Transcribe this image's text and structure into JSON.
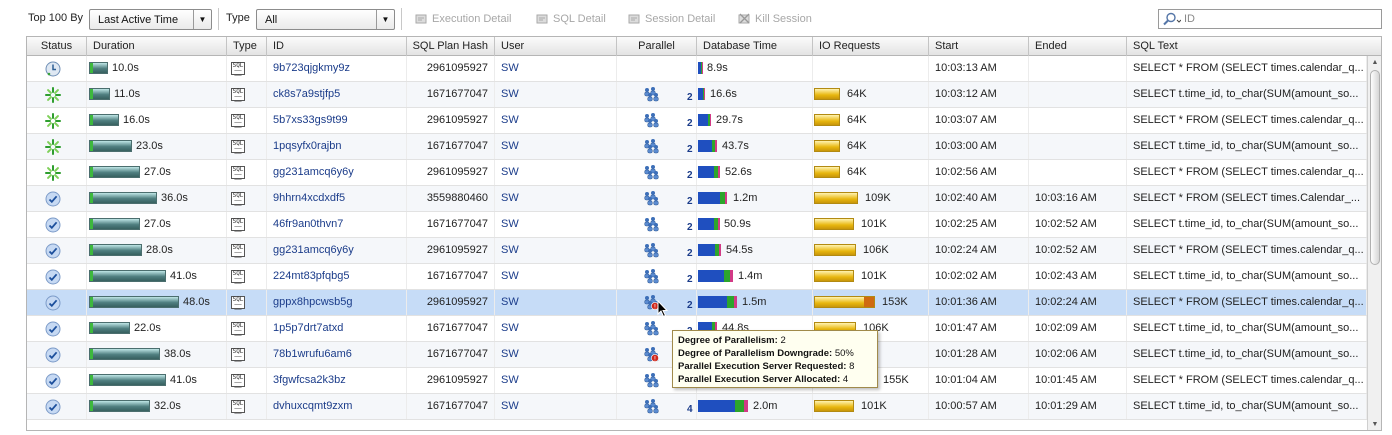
{
  "toolbar": {
    "top_label": "Top 100 By",
    "top_select": "Last Active Time",
    "type_label": "Type",
    "type_select": "All",
    "execution_detail": "Execution Detail",
    "sql_detail": "SQL Detail",
    "session_detail": "Session Detail",
    "kill_session": "Kill Session",
    "search_placeholder": "ID"
  },
  "columns": [
    "Status",
    "Duration",
    "Type",
    "ID",
    "SQL Plan Hash",
    "User",
    "Parallel",
    "Database Time",
    "IO Requests",
    "Start",
    "Ended",
    "SQL Text"
  ],
  "colors": {
    "selected_row": "#c6dcf7",
    "link": "#1b3c8a",
    "io_bar": "#e8b70f",
    "duration_bar": "#4f7f80"
  },
  "rows": [
    {
      "status": "clock",
      "duration": "10.0s",
      "dur_frac": 0.19,
      "id": "9b723qjgkmy9z",
      "hash": "2961095927",
      "user": "SW",
      "parallel": "",
      "parallel_status": "",
      "db_time": "8.9s",
      "db_frac": 0.03,
      "io": "",
      "io_frac": 0,
      "start": "10:03:13 AM",
      "ended": "",
      "sql": "SELECT * FROM   (SELECT times.calendar_q..."
    },
    {
      "status": "running",
      "duration": "11.0s",
      "dur_frac": 0.21,
      "id": "ck8s7a9stjfp5",
      "hash": "1671677047",
      "user": "SW",
      "parallel": "2",
      "parallel_status": "",
      "db_time": "16.6s",
      "db_frac": 0.06,
      "io": "64K",
      "io_frac": 0.38,
      "start": "10:03:12 AM",
      "ended": "",
      "sql": "SELECT t.time_id,   to_char(SUM(amount_so..."
    },
    {
      "status": "running",
      "duration": "16.0s",
      "dur_frac": 0.31,
      "id": "5b7xs33gs9t99",
      "hash": "2961095927",
      "user": "SW",
      "parallel": "2",
      "parallel_status": "",
      "db_time": "29.7s",
      "db_frac": 0.11,
      "io": "64K",
      "io_frac": 0.38,
      "start": "10:03:07 AM",
      "ended": "",
      "sql": "SELECT * FROM   (SELECT times.calendar_q..."
    },
    {
      "status": "running",
      "duration": "23.0s",
      "dur_frac": 0.44,
      "id": "1pqsyfx0rajbn",
      "hash": "1671677047",
      "user": "SW",
      "parallel": "2",
      "parallel_status": "",
      "db_time": "43.7s",
      "db_frac": 0.16,
      "io": "64K",
      "io_frac": 0.38,
      "start": "10:03:00 AM",
      "ended": "",
      "sql": "SELECT t.time_id,   to_char(SUM(amount_so..."
    },
    {
      "status": "running",
      "duration": "27.0s",
      "dur_frac": 0.52,
      "id": "gg231amcq6y6y",
      "hash": "2961095927",
      "user": "SW",
      "parallel": "2",
      "parallel_status": "",
      "db_time": "52.6s",
      "db_frac": 0.19,
      "io": "64K",
      "io_frac": 0.38,
      "start": "10:02:56 AM",
      "ended": "",
      "sql": "SELECT * FROM   (SELECT times.calendar_q..."
    },
    {
      "status": "done",
      "duration": "36.0s",
      "dur_frac": 0.69,
      "id": "9hhrn4xcdxdf5",
      "hash": "3559880460",
      "user": "SW",
      "parallel": "2",
      "parallel_status": "",
      "db_time": "1.2m",
      "db_frac": 0.26,
      "io": "109K",
      "io_frac": 0.64,
      "start": "10:02:40 AM",
      "ended": "10:03:16 AM",
      "sql": "SELECT * FROM   (SELECT times.Calendar_..."
    },
    {
      "status": "done",
      "duration": "27.0s",
      "dur_frac": 0.52,
      "id": "46fr9an0thvn7",
      "hash": "1671677047",
      "user": "SW",
      "parallel": "2",
      "parallel_status": "",
      "db_time": "50.9s",
      "db_frac": 0.18,
      "io": "101K",
      "io_frac": 0.59,
      "start": "10:02:25 AM",
      "ended": "10:02:52 AM",
      "sql": "SELECT t.time_id,   to_char(SUM(amount_so..."
    },
    {
      "status": "done",
      "duration": "28.0s",
      "dur_frac": 0.54,
      "id": "gg231amcq6y6y",
      "hash": "2961095927",
      "user": "SW",
      "parallel": "2",
      "parallel_status": "",
      "db_time": "54.5s",
      "db_frac": 0.2,
      "io": "106K",
      "io_frac": 0.62,
      "start": "10:02:24 AM",
      "ended": "10:02:52 AM",
      "sql": "SELECT * FROM   (SELECT times.calendar_q..."
    },
    {
      "status": "done",
      "duration": "41.0s",
      "dur_frac": 0.79,
      "id": "224mt83pfqbg5",
      "hash": "1671677047",
      "user": "SW",
      "parallel": "2",
      "parallel_status": "",
      "db_time": "1.4m",
      "db_frac": 0.3,
      "io": "101K",
      "io_frac": 0.59,
      "start": "10:02:02 AM",
      "ended": "10:02:43 AM",
      "sql": "SELECT t.time_id,   to_char(SUM(amount_so..."
    },
    {
      "status": "done",
      "duration": "48.0s",
      "dur_frac": 0.92,
      "id": "gppx8hpcwsb5g",
      "hash": "2961095927",
      "user": "SW",
      "parallel": "2",
      "parallel_status": "downgrade",
      "db_time": "1.5m",
      "db_frac": 0.33,
      "io": "153K",
      "io_frac": 0.9,
      "start": "10:01:36 AM",
      "ended": "10:02:24 AM",
      "sql": "SELECT * FROM   (SELECT times.calendar_q..."
    },
    {
      "status": "done",
      "duration": "22.0s",
      "dur_frac": 0.42,
      "id": "1p5p7drt7atxd",
      "hash": "1671677047",
      "user": "SW",
      "parallel": "2",
      "parallel_status": "",
      "db_time": "44.8s",
      "db_frac": 0.16,
      "io": "106K",
      "io_frac": 0.62,
      "start": "10:01:47 AM",
      "ended": "10:02:09 AM",
      "sql": "SELECT t.time_id,   to_char(SUM(amount_so..."
    },
    {
      "status": "done",
      "duration": "38.0s",
      "dur_frac": 0.73,
      "id": "78b1wrufu6am6",
      "hash": "1671677047",
      "user": "SW",
      "parallel": "2",
      "parallel_status": "downgrade",
      "db_time": "",
      "db_frac": 0.2,
      "io": "",
      "io_frac": 0.62,
      "start": "10:01:28 AM",
      "ended": "10:02:06 AM",
      "sql": "SELECT t.time_id,   to_char(SUM(amount_so..."
    },
    {
      "status": "done",
      "duration": "41.0s",
      "dur_frac": 0.79,
      "id": "3fgwfcsa2k3bz",
      "hash": "2961095927",
      "user": "SW",
      "parallel": "4",
      "parallel_status": "",
      "db_time": "",
      "db_frac": 0.3,
      "io": "155K",
      "io_frac": 0.91,
      "start": "10:01:04 AM",
      "ended": "10:01:45 AM",
      "sql": "SELECT * FROM   (SELECT times.calendar_q..."
    },
    {
      "status": "done",
      "duration": "32.0s",
      "dur_frac": 0.62,
      "id": "dvhuxcqmt9zxm",
      "hash": "1671677047",
      "user": "SW",
      "parallel": "4",
      "parallel_status": "",
      "db_time": "2.0m",
      "db_frac": 0.43,
      "io": "101K",
      "io_frac": 0.59,
      "start": "10:00:57 AM",
      "ended": "10:01:29 AM",
      "sql": "SELECT t.time_id,   to_char(SUM(amount_so..."
    }
  ],
  "selected_index": 9,
  "tooltip": {
    "dop_label": "Degree of Parallelism:",
    "dop": "2",
    "downgrade_label": "Degree of Parallelism Downgrade:",
    "downgrade": "50%",
    "requested_label": "Parallel Execution Server Requested:",
    "requested": "8",
    "allocated_label": "Parallel Execution Server Allocated:",
    "allocated": "4"
  }
}
